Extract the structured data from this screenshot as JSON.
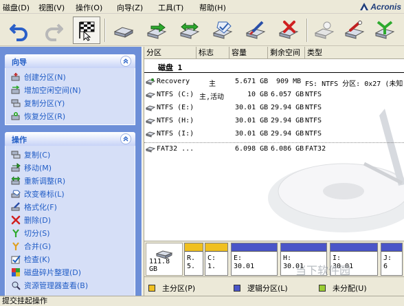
{
  "menu": [
    {
      "label": "磁盘(D)"
    },
    {
      "label": "视图(V)"
    },
    {
      "label": "操作(O)"
    },
    {
      "label": "向导(Z)"
    },
    {
      "label": "工具(T)"
    },
    {
      "label": "帮助(H)"
    }
  ],
  "brand": {
    "name": "Acronis",
    "color": "#1f3d7a"
  },
  "toolbar": [
    {
      "icon": "undo-icon"
    },
    {
      "icon": "redo-icon"
    },
    {
      "icon": "commit-flag-icon",
      "pressed": true
    },
    {
      "icon": "disk-icon"
    },
    {
      "icon": "disk-move-icon"
    },
    {
      "icon": "disk-resize-icon"
    },
    {
      "icon": "disk-label-icon"
    },
    {
      "icon": "disk-format-icon"
    },
    {
      "icon": "disk-delete-icon"
    },
    {
      "icon": "disk-create-icon"
    },
    {
      "icon": "disk-hide-icon"
    },
    {
      "icon": "disk-merge-icon"
    }
  ],
  "sidebar": {
    "wizards": {
      "title": "向导",
      "items": [
        {
          "label": "创建分区(N)",
          "icon": "create-partition-icon"
        },
        {
          "label": "增加空闲空间(N)",
          "icon": "increase-free-space-icon"
        },
        {
          "label": "复制分区(Y)",
          "icon": "copy-partition-icon"
        },
        {
          "label": "恢复分区(R)",
          "icon": "recover-partition-icon"
        }
      ]
    },
    "operations": {
      "title": "操作",
      "items": [
        {
          "label": "复制(C)",
          "icon": "copy-icon"
        },
        {
          "label": "移动(M)",
          "icon": "move-icon"
        },
        {
          "label": "重新调整(R)",
          "icon": "resize-icon"
        },
        {
          "label": "改变卷标(L)",
          "icon": "change-label-icon"
        },
        {
          "label": "格式化(F)",
          "icon": "format-icon"
        },
        {
          "label": "删除(D)",
          "icon": "delete-icon"
        },
        {
          "label": "切分(S)",
          "icon": "split-icon"
        },
        {
          "label": "合并(G)",
          "icon": "merge-icon"
        },
        {
          "label": "检查(K)",
          "icon": "check-icon"
        },
        {
          "label": "磁盘碎片整理(D)",
          "icon": "defrag-icon"
        },
        {
          "label": "资源管理器查看(B)",
          "icon": "explorer-view-icon"
        }
      ]
    }
  },
  "list": {
    "columns": [
      "分区",
      "标志",
      "容量",
      "剩余空间",
      "类型"
    ],
    "disk_title": "磁盘 1",
    "rows": [
      {
        "name": "Recovery",
        "flag": "主",
        "capacity": "5.671 GB",
        "free": "909 MB",
        "type": "FS: NTFS 分区: 0x27 (未知"
      },
      {
        "name": "NTFS (C:)",
        "flag": "主,活动",
        "capacity": "10 GB",
        "free": "6.057 GB",
        "type": "NTFS"
      },
      {
        "name": "NTFS (E:)",
        "flag": "",
        "capacity": "30.01 GB",
        "free": "29.94 GB",
        "type": "NTFS"
      },
      {
        "name": "NTFS (H:)",
        "flag": "",
        "capacity": "30.01 GB",
        "free": "29.94 GB",
        "type": "NTFS"
      },
      {
        "name": "NTFS (I:)",
        "flag": "",
        "capacity": "30.01 GB",
        "free": "29.94 GB",
        "type": "NTFS"
      },
      {
        "name": "FAT32 ...",
        "flag": "",
        "capacity": "6.098 GB",
        "free": "6.086 GB",
        "type": "FAT32"
      }
    ]
  },
  "diskmap": {
    "disk_capacity": "111.8 GB",
    "partitions": [
      {
        "l1": "R.",
        "l2": "5.",
        "color": "#f0c020"
      },
      {
        "l1": "C:",
        "l2": "1.",
        "color": "#f0c020"
      },
      {
        "l1": "E:",
        "l2": "30.01",
        "color": "#4a55c8"
      },
      {
        "l1": "H:",
        "l2": "30.01",
        "color": "#4a55c8"
      },
      {
        "l1": "I:",
        "l2": "30.01",
        "color": "#4a55c8"
      },
      {
        "l1": "J:",
        "l2": "6",
        "color": "#4a55c8"
      }
    ]
  },
  "legend": [
    {
      "label": "主分区(P)",
      "color": "#f0c020"
    },
    {
      "label": "逻辑分区(L)",
      "color": "#4a55c8"
    },
    {
      "label": "未分配(U)",
      "color": "#9acd32"
    }
  ],
  "watermark_text": "当下软件园",
  "status": "提交挂起操作"
}
